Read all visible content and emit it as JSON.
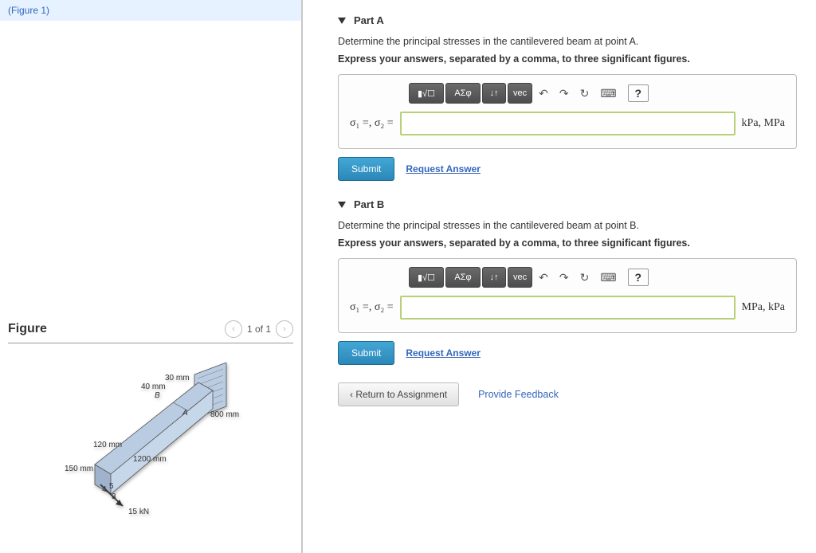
{
  "left": {
    "figure_link": "(Figure 1)",
    "figure_title": "Figure",
    "nav_text": "1 of 1",
    "dimensions": {
      "d30": "30 mm",
      "d40": "40 mm",
      "labelB": "B",
      "labelA": "A",
      "d800": "800 mm",
      "d120": "120 mm",
      "d1200": "1200 mm",
      "d150": "150 mm",
      "d4": "4",
      "d5": "5",
      "d3": "3",
      "load": "15 kN"
    }
  },
  "parts": [
    {
      "title": "Part A",
      "prompt": "Determine the principal stresses in the cantilevered beam at point A.",
      "instruct": "Express your answers, separated by a comma, to three significant figures.",
      "sigma_label": "σ₁ =, σ₂ =",
      "units": "kPa, MPa",
      "submit": "Submit",
      "request": "Request Answer"
    },
    {
      "title": "Part B",
      "prompt": "Determine the principal stresses in the cantilevered beam at point B.",
      "instruct": "Express your answers, separated by a comma, to three significant figures.",
      "sigma_label": "σ₁ =, σ₂ =",
      "units": "MPa, kPa",
      "submit": "Submit",
      "request": "Request Answer"
    }
  ],
  "toolbar": {
    "frac": "▮√☐",
    "greek": "ΑΣφ",
    "sub": "↓↑",
    "vec": "vec",
    "undo": "↶",
    "redo": "↷",
    "reset": "↻",
    "kb": "⌨",
    "help": "?"
  },
  "footer": {
    "return": "Return to Assignment",
    "feedback": "Provide Feedback"
  }
}
